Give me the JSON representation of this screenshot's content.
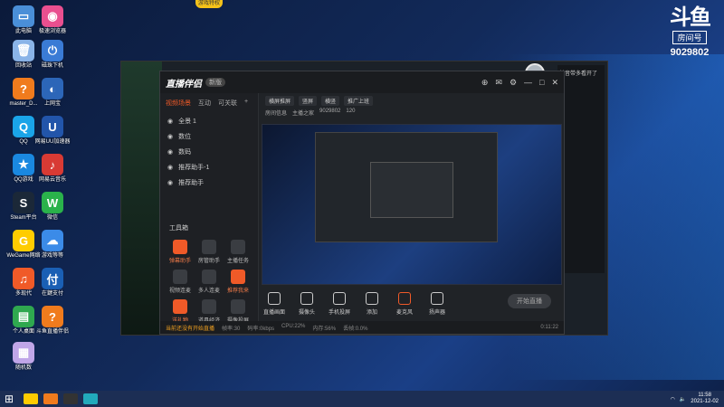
{
  "desktop_icons": [
    {
      "label": "此电脑",
      "color": "#4a8fd8",
      "glyph": "▭"
    },
    {
      "label": "极速浏览器",
      "color": "#e94f8f",
      "glyph": "◉"
    },
    {
      "label": "回收站",
      "color": "#8ab4e8",
      "glyph": "🗑"
    },
    {
      "label": "磁珠下机",
      "color": "#3a7bd5",
      "glyph": "⏻"
    },
    {
      "label": "master_D...",
      "color": "#f07b1d",
      "glyph": "?"
    },
    {
      "label": "上网宝",
      "color": "#2c66b8",
      "glyph": "◐"
    },
    {
      "label": "QQ",
      "color": "#1aa4e8",
      "glyph": "Q"
    },
    {
      "label": "网易UU加速器",
      "color": "#2255aa",
      "glyph": "U"
    },
    {
      "label": "QQ游戏",
      "color": "#1a88e0",
      "glyph": "★"
    },
    {
      "label": "网易云音乐",
      "color": "#d83a34",
      "glyph": "♪"
    },
    {
      "label": "Steam平台",
      "color": "#1b2838",
      "glyph": "S"
    },
    {
      "label": "微信",
      "color": "#2ab24b",
      "glyph": "W"
    },
    {
      "label": "WeGame网络",
      "color": "#ffcc00",
      "glyph": "G"
    },
    {
      "label": "游戏等等",
      "color": "#3b8be8",
      "glyph": "☁"
    },
    {
      "label": "多现代",
      "color": "#f05a28",
      "glyph": "♫"
    },
    {
      "label": "在鍵支付",
      "color": "#1a5fb4",
      "glyph": "付"
    },
    {
      "label": "个人桌面",
      "color": "#2fa84f",
      "glyph": "▤"
    },
    {
      "label": "斗鱼直播伴侣",
      "color": "#f07b1d",
      "glyph": "?"
    },
    {
      "label": "随机数",
      "color": "#c0a6e8",
      "glyph": "▦"
    }
  ],
  "game_badge": "游戏特权",
  "douyu": {
    "logo": "斗鱼",
    "sub": "房间号",
    "room": "9029802"
  },
  "app": {
    "name": "直播伴侣",
    "version": "新版",
    "title_icons": [
      "⊕",
      "✉",
      "⚙",
      "—",
      "□",
      "✕"
    ],
    "tabs": [
      "视频场景",
      "互动",
      "可关联",
      "+"
    ],
    "scenes": [
      "全景 1",
      "数位",
      "数码",
      "推荐助手-1",
      "推荐助手"
    ],
    "tools_title": "工具箱",
    "tools": [
      {
        "label": "弹幕助手",
        "hot": true
      },
      {
        "label": "房管助手",
        "hot": false
      },
      {
        "label": "主播任务",
        "hot": false
      },
      {
        "label": "视频连麦",
        "hot": false
      },
      {
        "label": "多人连麦",
        "hot": false
      },
      {
        "label": "推荐我来",
        "hot": true
      },
      {
        "label": "送礼物",
        "hot": true
      },
      {
        "label": "道具经济",
        "hot": false
      },
      {
        "label": "摄像投屏",
        "hot": false
      }
    ],
    "preview_toolbar": [
      "横屏推屏",
      "竖屏",
      "横竖",
      "推广上班"
    ],
    "room_tags": [
      "房间信息",
      "主播之家",
      "",
      ""
    ],
    "room_id": "9029802",
    "room_extra": "120",
    "controls": [
      "直播画面",
      "摄像头",
      "手机投屏",
      "添加",
      "麦克风",
      "扬声器"
    ],
    "go_live": "开始直播",
    "statusbar": {
      "warn": "当前还没有开始直播",
      "items": [
        "帧率:30",
        "码率:0kbps",
        "CPU:22%",
        "内存:56%",
        "丢帧:0.0%"
      ],
      "time": "0:11:22"
    }
  },
  "chat_lines": [
    "抖音带多看开了",
    "",
    "",
    "",
    ""
  ],
  "taskbar": {
    "time": "11:58",
    "date": "2021-12-02"
  }
}
